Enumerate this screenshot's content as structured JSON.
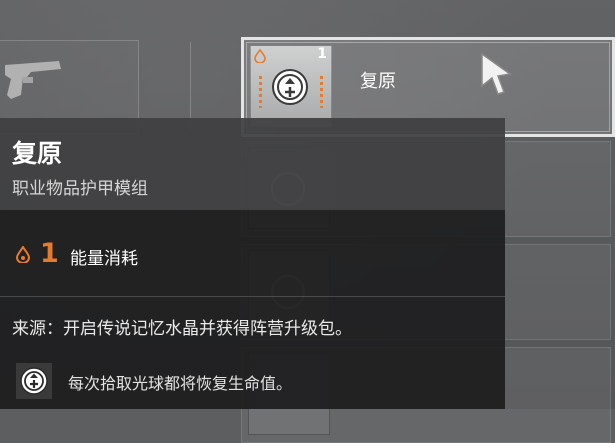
{
  "colors": {
    "accent_orange": "#e87a2d",
    "selected_border": "#e4e4e4",
    "tooltip_header": "#404042",
    "tooltip_body": "#1c1c1d"
  },
  "mods": [
    {
      "name": "复原",
      "cost": "1",
      "icon": "restore-orb-icon",
      "selected": true
    },
    {
      "name": "",
      "cost": "",
      "icon": "mod-icon",
      "selected": false
    },
    {
      "name": "",
      "cost": "",
      "icon": "mod-icon",
      "selected": false
    },
    {
      "name": "",
      "cost": "",
      "icon": "mod-icon",
      "selected": false
    }
  ],
  "tooltip": {
    "title": "复原",
    "subtitle": "职业物品护甲模组",
    "energy_cost": "1",
    "energy_label": "能量消耗",
    "source": "来源：开启传说记忆水晶并获得阵营升级包。",
    "perk_text": "每次拾取光球都将恢复生命值。",
    "perk_icon": "restore-orb-icon"
  }
}
